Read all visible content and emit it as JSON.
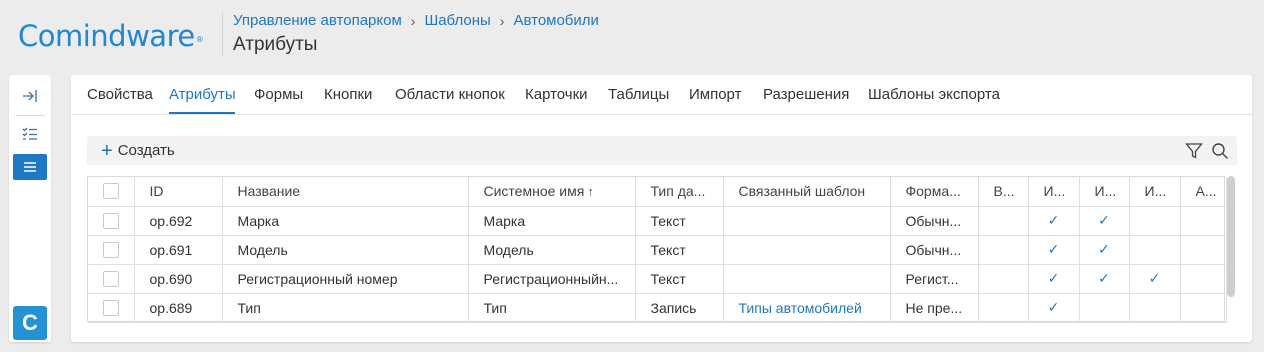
{
  "header": {
    "logo_text": "Comindware",
    "logo_mark": "®",
    "breadcrumb": [
      "Управление автопарком",
      "Шаблоны",
      "Автомобили"
    ],
    "breadcrumb_separator": "›",
    "page_title": "Атрибуты"
  },
  "rail": {
    "icons": [
      "collapse-to-right-icon",
      "checklist-icon",
      "list-icon"
    ],
    "active_index": 2,
    "app_badge": "C"
  },
  "tabs": [
    "Свойства",
    "Атрибуты",
    "Формы",
    "Кнопки",
    "Области кнопок",
    "Карточки",
    "Таблицы",
    "Импорт",
    "Разрешения",
    "Шаблоны экспорта"
  ],
  "active_tab": "Атрибуты",
  "toolbar": {
    "create_label": "Создать",
    "icons": [
      "filter-icon",
      "search-icon"
    ]
  },
  "table": {
    "columns": [
      "",
      "ID",
      "Название",
      "Системное имя",
      "Тип да...",
      "Связанный шаблон",
      "Форма...",
      "В...",
      "И...",
      "И...",
      "И...",
      "А..."
    ],
    "sorted_column": "Системное имя",
    "sort_direction": "ascending",
    "rows": [
      {
        "id": "op.692",
        "name": "Марка",
        "system_name": "Марка",
        "type": "Текст",
        "template": "",
        "format": "Обычн...",
        "v": "",
        "i1": true,
        "i2": true,
        "i3": false,
        "a": ""
      },
      {
        "id": "op.691",
        "name": "Модель",
        "system_name": "Модель",
        "type": "Текст",
        "template": "",
        "format": "Обычн...",
        "v": "",
        "i1": true,
        "i2": true,
        "i3": false,
        "a": ""
      },
      {
        "id": "op.690",
        "name": "Регистрационный номер",
        "system_name": "Регистрационныйн...",
        "type": "Текст",
        "template": "",
        "format": "Регист...",
        "v": "",
        "i1": true,
        "i2": true,
        "i3": true,
        "a": ""
      },
      {
        "id": "op.689",
        "name": "Тип",
        "system_name": "Тип",
        "type": "Запись",
        "template": "Типы автомобилей",
        "format": "Не пре...",
        "v": "",
        "i1": true,
        "i2": false,
        "i3": false,
        "a": ""
      }
    ],
    "tick_glyph": "✓"
  },
  "colors": {
    "accent": "#1f78c1",
    "logo": "#1f88d0",
    "background": "#ececec"
  }
}
